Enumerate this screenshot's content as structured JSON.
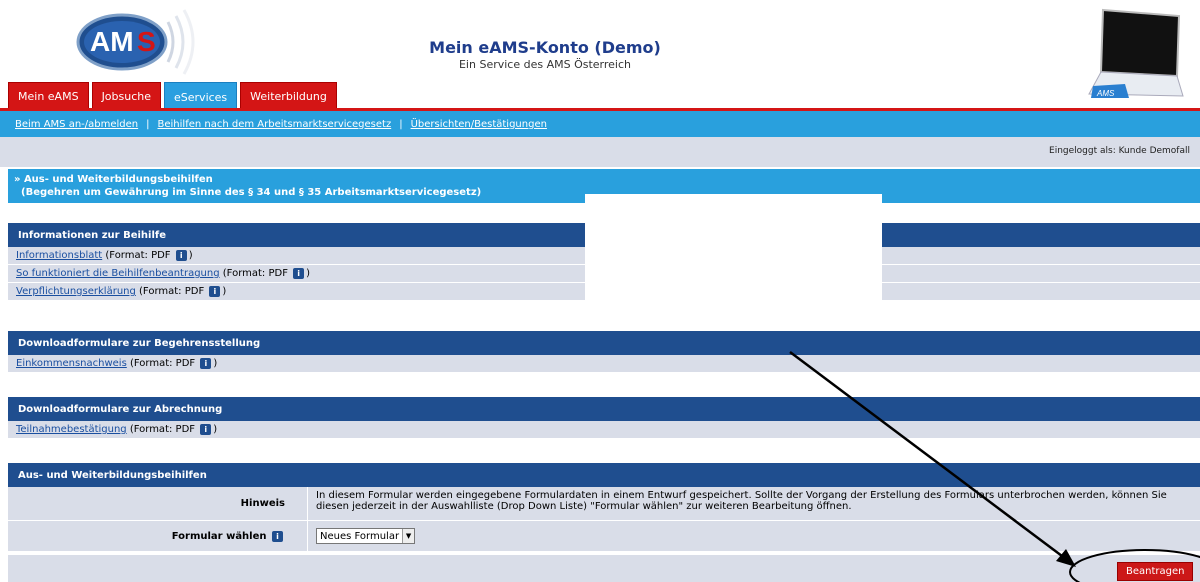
{
  "header": {
    "logo_text": "AMS",
    "title": "Mein eAMS-Konto (Demo)",
    "subtitle": "Ein Service des AMS Österreich",
    "laptop_text": "AMS"
  },
  "tabs": [
    {
      "label": "Mein eAMS",
      "active": false
    },
    {
      "label": "Jobsuche",
      "active": false
    },
    {
      "label": "eServices",
      "active": true
    },
    {
      "label": "Weiterbildung",
      "active": false
    }
  ],
  "subnav": {
    "links": [
      "Beim AMS an-/abmelden",
      "Beihilfen nach dem Arbeitsmarktservicegesetz",
      "Übersichten/Bestätigungen"
    ],
    "separator": "|"
  },
  "logged_in": "Eingeloggt als: Kunde Demofall",
  "page_heading": {
    "line1": "» Aus- und Weiterbildungsbeihilfen",
    "line2": "(Begehren um Gewährung im Sinne des § 34 und § 35 Arbeitsmarktservicegesetz)"
  },
  "format_text": "(Format: PDF",
  "format_close": ")",
  "info_icon_glyph": "i",
  "sections": {
    "info": {
      "title": "Informationen zur Beihilfe",
      "items": [
        "Informationsblatt",
        "So funktioniert die Beihilfenbeantragung",
        "Verpflichtungserklärung"
      ]
    },
    "download": {
      "title": "Downloadformulare zur Begehrensstellung",
      "items": [
        "Einkommensnachweis"
      ]
    },
    "billing": {
      "title": "Downloadformulare zur Abrechnung",
      "items": [
        "Teilnahmebestätigung"
      ]
    }
  },
  "form": {
    "title": "Aus- und Weiterbildungsbeihilfen",
    "hint_label": "Hinweis",
    "hint_text": "In diesem Formular werden eingegebene Formulardaten in einem Entwurf gespeichert. Sollte der Vorgang der Erstellung des Formulars unterbrochen werden, können Sie diesen jederzeit in der Auswahlliste (Drop Down Liste) \"Formular wählen\" zur weiteren Bearbeitung öffnen.",
    "select_label": "Formular wählen",
    "select_value": "Neues Formular",
    "submit_label": "Beantragen"
  },
  "colors": {
    "brand_red": "#d41515",
    "brand_blue": "#29a0dd",
    "section_navy": "#1f4e8f",
    "row_gray": "#d9dde8"
  }
}
